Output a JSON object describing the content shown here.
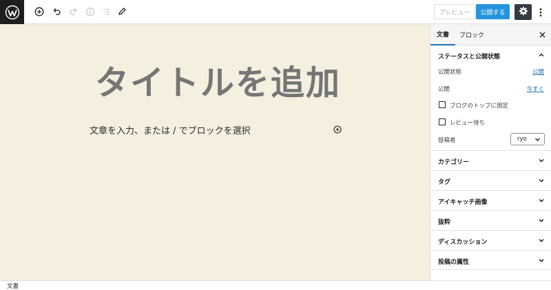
{
  "toolbar": {
    "preview_label": "プレビュー",
    "publish_label": "公開する"
  },
  "editor": {
    "title_placeholder": "タイトルを追加",
    "block_placeholder": "文章を入力、または / でブロックを選択"
  },
  "sidebar": {
    "tabs": [
      {
        "label": "文書",
        "active": true
      },
      {
        "label": "ブロック",
        "active": false
      }
    ],
    "status_panel": {
      "title": "ステータスと公開状態",
      "rows": [
        {
          "label": "公開状態",
          "value": "公開"
        },
        {
          "label": "公開",
          "value": "今すぐ"
        }
      ],
      "checkboxes": [
        {
          "label": "ブログのトップに固定",
          "checked": false
        },
        {
          "label": "レビュー待ち",
          "checked": false
        }
      ],
      "author_label": "投稿者",
      "author_value": "ryo"
    },
    "panels": [
      {
        "title": "カテゴリー"
      },
      {
        "title": "タグ"
      },
      {
        "title": "アイキャッチ画像"
      },
      {
        "title": "抜粋"
      },
      {
        "title": "ディスカッション"
      },
      {
        "title": "投稿の属性"
      }
    ]
  },
  "footer": {
    "breadcrumb": "文書"
  },
  "colors": {
    "accent": "#2271b1",
    "publish_button": "#2495dc",
    "editor_background": "#f5efe0",
    "logo_background": "#1e1e1e"
  },
  "icons": [
    "wordpress-logo-icon",
    "add-block-icon",
    "undo-icon",
    "redo-icon",
    "info-icon",
    "list-view-icon",
    "edit-icon",
    "gear-icon",
    "more-vertical-icon",
    "close-icon",
    "chevron-up-icon",
    "chevron-down-icon",
    "plus-circle-icon"
  ]
}
